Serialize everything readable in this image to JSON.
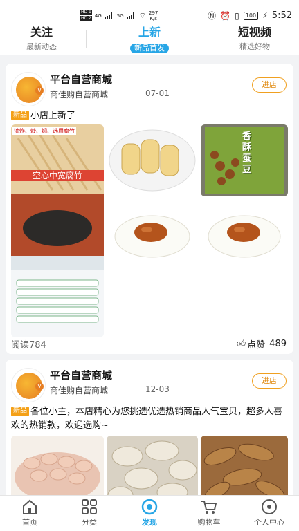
{
  "status": {
    "hd1": "HD 1",
    "hd2": "HD 2",
    "net1": "4G",
    "net2": "5G",
    "speed": "297",
    "speed_unit": "K/s",
    "battery": "100",
    "time": "5:52"
  },
  "tabs": [
    {
      "title": "关注",
      "subtitle": "最新动态"
    },
    {
      "title": "上新",
      "subtitle": "新品首发"
    },
    {
      "title": "短视频",
      "subtitle": "精选好物"
    }
  ],
  "posts": [
    {
      "store": "平台自营商城",
      "sub": "商佳购自营商城",
      "date": "07-01",
      "enter": "进店",
      "badge": "新品",
      "text": "小店上新了",
      "img_caption": "空心中宽腐竹",
      "img_banner": "油炸、炒、焖、选用腐竹",
      "img_snack": "香酥蚕豆",
      "reads": "阅读784",
      "likes_label": "点赞",
      "likes": "489"
    },
    {
      "store": "平台自营商城",
      "sub": "商佳购自营商城",
      "date": "12-03",
      "enter": "进店",
      "badge": "新品",
      "text": "各位小主，本店精心为您挑选优选热销商品人气宝贝，超多人喜欢的热销款，欢迎选购~"
    }
  ],
  "nav": [
    {
      "label": "首页",
      "icon": "home-icon"
    },
    {
      "label": "分类",
      "icon": "category-icon"
    },
    {
      "label": "发现",
      "icon": "discover-icon"
    },
    {
      "label": "购物车",
      "icon": "cart-icon"
    },
    {
      "label": "个人中心",
      "icon": "profile-icon"
    }
  ],
  "colors": {
    "accent": "#27a6e6",
    "badge": "#f4a017",
    "enter_border": "#f0a020"
  }
}
